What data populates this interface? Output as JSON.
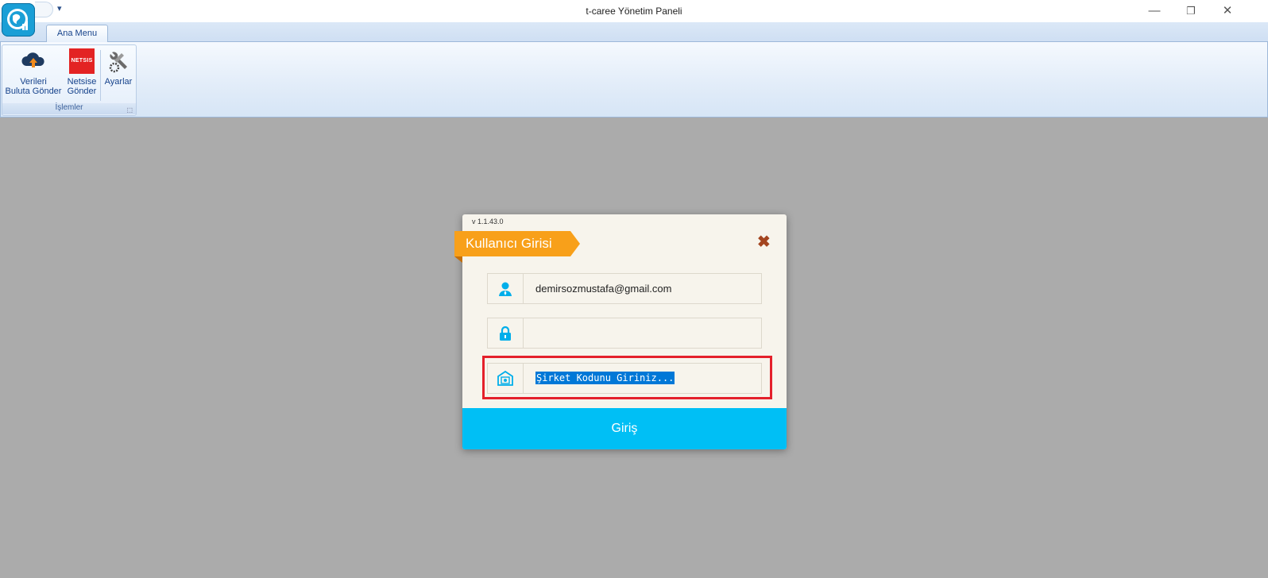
{
  "window": {
    "title": "t-caree Yönetim Paneli",
    "controls": {
      "minimize": "—",
      "restore": "❐",
      "close": "✕"
    },
    "qat_arrow": "▾"
  },
  "ribbon": {
    "tabs": [
      {
        "label": "Ana Menu",
        "active": true
      }
    ],
    "groups": [
      {
        "label": "İşlemler",
        "buttons": [
          {
            "line1": "Verileri",
            "line2": "Buluta Gönder",
            "icon": "cloud-upload-icon"
          },
          {
            "line1": "Netsise",
            "line2": "Gönder",
            "icon": "netsis-logo",
            "logo_text": "NETSIS"
          },
          {
            "line1": "Ayarlar",
            "line2": "",
            "icon": "tools-icon"
          }
        ]
      }
    ]
  },
  "dialog": {
    "version": "v 1.1.43.0",
    "title": "Kullanıcı Girisi",
    "close_label": "✖",
    "email": {
      "icon": "user-icon",
      "value": "demirsozmustafa@gmail.com"
    },
    "password": {
      "icon": "lock-icon",
      "value": ""
    },
    "company_code": {
      "icon": "building-icon",
      "value": "Şirket Kodunu Giriniz...",
      "selected": true
    },
    "login_label": "Giriş"
  },
  "colors": {
    "workspace": "#ababab",
    "banner": "#f8a01a",
    "login_button": "#00bff5",
    "highlight_frame": "#e4202b",
    "selection": "#0078d7",
    "icon_cyan": "#00aeea"
  }
}
